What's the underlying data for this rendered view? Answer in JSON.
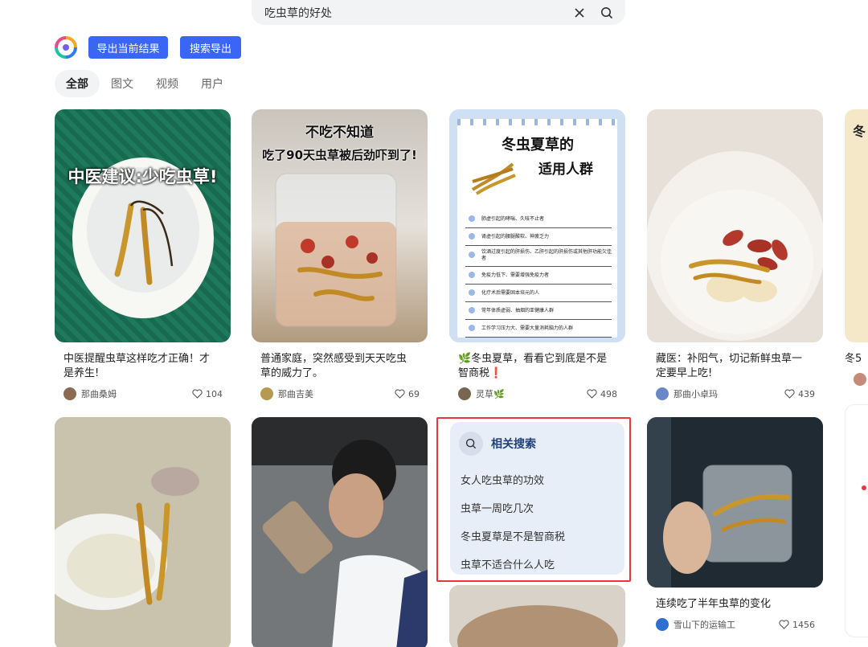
{
  "search": {
    "query": "吃虫草的好处"
  },
  "toolbar": {
    "export_current": "导出当前结果",
    "search_export": "搜索导出"
  },
  "tabs": [
    {
      "label": "全部",
      "active": true
    },
    {
      "label": "图文",
      "active": false
    },
    {
      "label": "视频",
      "active": false
    },
    {
      "label": "用户",
      "active": false
    }
  ],
  "cards": [
    {
      "overlay": "中医建议:少吃虫草!",
      "title": "中医提醒虫草这样吃才正确！才是养生!",
      "author": "那曲桑姆",
      "likes": "104"
    },
    {
      "overlay_1": "不吃不知道",
      "overlay_2": "吃了90天虫草被后劲吓到了!",
      "title": "普通家庭，突然感受到天天吃虫草的威力了。",
      "author": "那曲吉美",
      "likes": "69"
    },
    {
      "overlay_1": "冬虫夏草的",
      "overlay_2": "适用人群",
      "list": [
        "肺虚引起的哮喘、久咳不止者",
        "肾虚引起的腰腿酸软、神疲乏力",
        "饮酒过度引起的肝损伤、乙肝引起的肝损伤或其他肝功能欠佳者",
        "免疫力低下、需要增强免疫力者",
        "化疗术后需要固本培元的人",
        "常年体质虚弱、抽烟的亚健康人群",
        "工作学习压力大、需要大量消耗脑力的人群"
      ],
      "title": "🌿冬虫夏草，看看它到底是不是智商税❗",
      "author": "灵草🌿",
      "likes": "498"
    },
    {
      "title": "藏医：补阳气，切记新鲜虫草一定要早上吃!",
      "author": "那曲小卓玛",
      "likes": "439"
    },
    {
      "title": "冬5",
      "overlay": "冬"
    },
    {
      "title": "连续吃了半年虫草的变化",
      "author": "雪山下的运输工",
      "likes": "1456"
    }
  ],
  "related": {
    "title": "相关搜索",
    "items": [
      "女人吃虫草的功效",
      "虫草一周吃几次",
      "冬虫夏草是不是智商税",
      "虫草不适合什么人吃"
    ]
  },
  "colors": {
    "accent": "#3b66f5",
    "highlight_border": "#e8383d"
  }
}
